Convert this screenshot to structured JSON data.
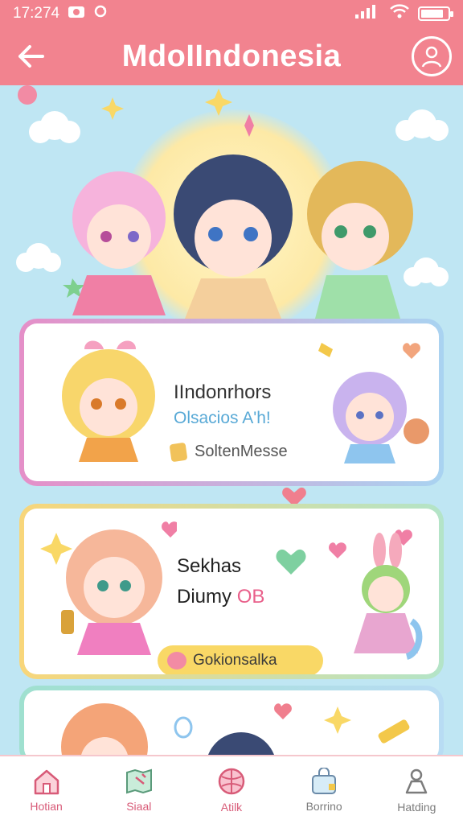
{
  "status_bar": {
    "time": "17:274",
    "battery_level": 0.85
  },
  "app_bar": {
    "title": "MdoIIndonesia"
  },
  "cards": [
    {
      "title": "IIndonrhors",
      "subtitle": "Olsacios A'h!",
      "meta": "SoltenMesse"
    },
    {
      "line1": "Sekhas",
      "line2_main": "Diumy",
      "line2_accent": "OB",
      "pill": "Gokionsalka"
    }
  ],
  "bottom_nav": [
    {
      "label": "Hotian",
      "icon": "home-icon",
      "active": true
    },
    {
      "label": "Siaal",
      "icon": "map-icon",
      "active": false
    },
    {
      "label": "Atilk",
      "icon": "ball-icon",
      "active": false
    },
    {
      "label": "Borrino",
      "icon": "bag-icon",
      "active": false
    },
    {
      "label": "Hatding",
      "icon": "person-icon",
      "active": false
    }
  ],
  "colors": {
    "accent": "#f2838f",
    "background": "#bfe6f3",
    "card1_border": "#e58fc8",
    "card2_border": "#f8d67a",
    "card3_border": "#9fe0cf",
    "pill": "#f9d866"
  }
}
